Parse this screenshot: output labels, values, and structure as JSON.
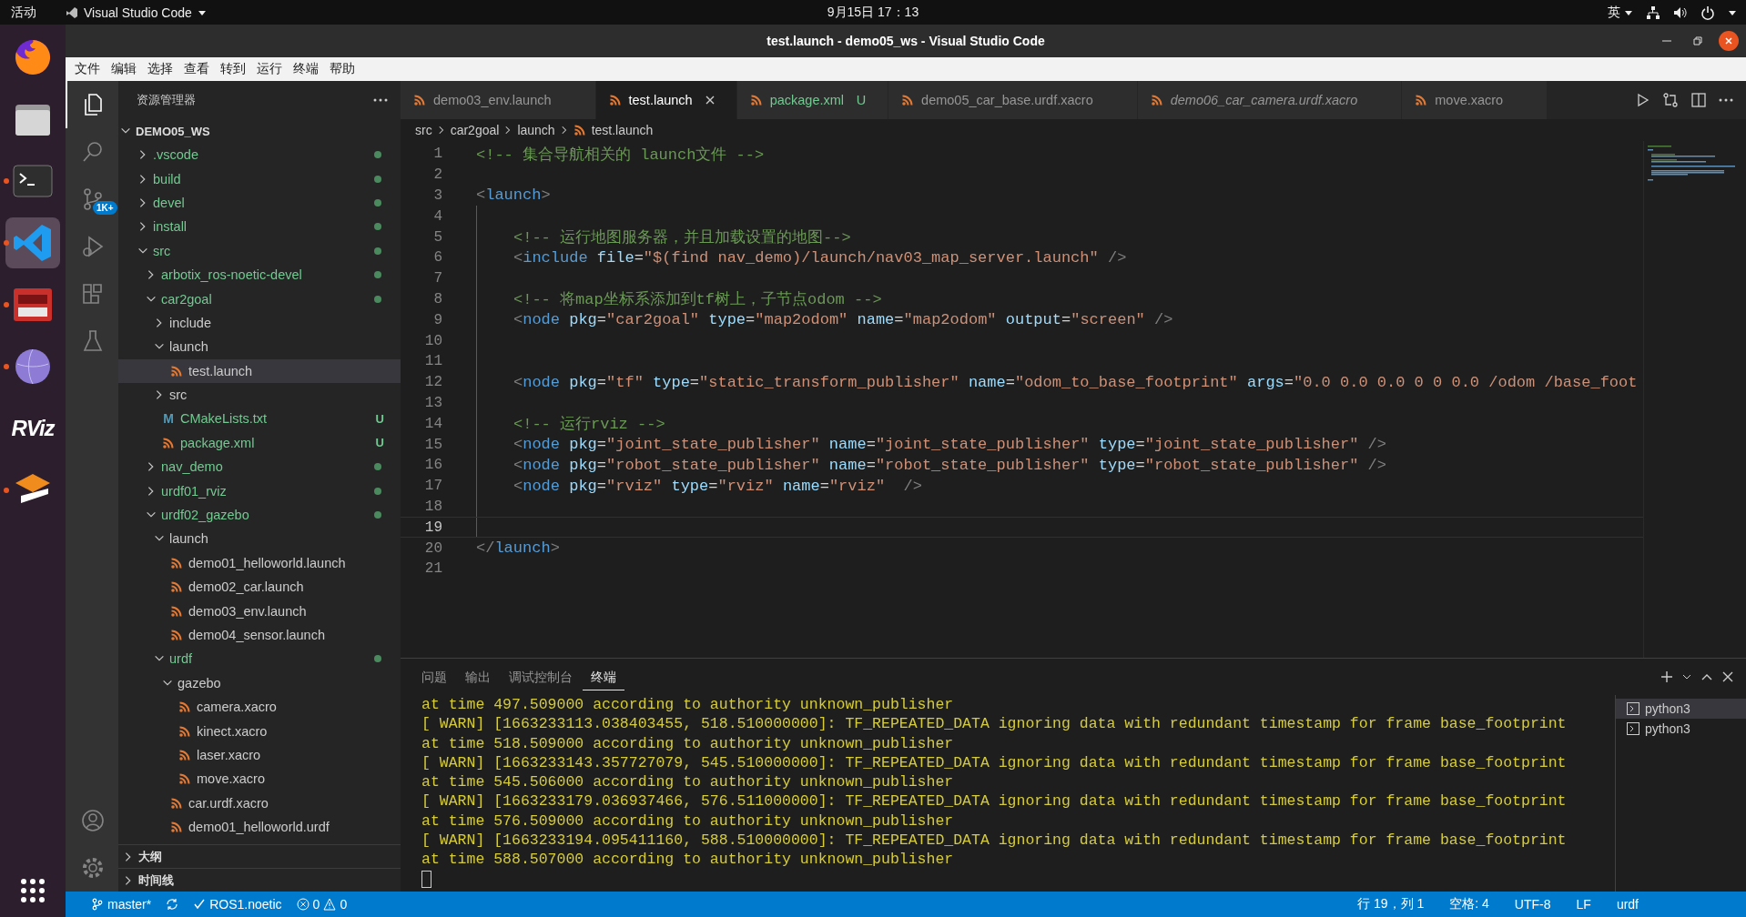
{
  "top_bar": {
    "activities": "活动",
    "app_menu": "Visual Studio Code",
    "clock": "9月15日  17：13",
    "input_method": "英"
  },
  "dock": {
    "items": [
      {
        "kind": "browser",
        "running": false,
        "selected": false
      },
      {
        "kind": "files",
        "running": false,
        "selected": false
      },
      {
        "kind": "terminal",
        "running": true,
        "selected": false
      },
      {
        "kind": "editor",
        "running": true,
        "selected": true
      },
      {
        "kind": "red-app",
        "running": true,
        "selected": false
      },
      {
        "kind": "sphere",
        "running": true,
        "selected": false
      },
      {
        "kind": "text",
        "label": "RViz",
        "running": false,
        "selected": false
      },
      {
        "kind": "layers",
        "running": true,
        "selected": false
      }
    ]
  },
  "window": {
    "title": "test.launch - demo05_ws - Visual Studio Code"
  },
  "menu": [
    "文件",
    "编辑",
    "选择",
    "查看",
    "转到",
    "运行",
    "终端",
    "帮助"
  ],
  "activity_bar": {
    "items": [
      {
        "kind": "explorer",
        "selected": true
      },
      {
        "kind": "search",
        "selected": false
      },
      {
        "kind": "source-control",
        "selected": false,
        "badge": "1K+"
      },
      {
        "kind": "run",
        "selected": false
      },
      {
        "kind": "extensions",
        "selected": false
      },
      {
        "kind": "testing",
        "selected": false
      }
    ]
  },
  "sidebar": {
    "title": "资源管理器",
    "root": {
      "label": "DEMO05_WS",
      "expanded": true
    },
    "tree": [
      {
        "kind": "folder",
        "label": ".vscode",
        "expanded": false,
        "untracked": true,
        "dot": true,
        "selected": false
      },
      {
        "kind": "folder",
        "label": "build",
        "expanded": false,
        "untracked": true,
        "dot": true,
        "selected": false
      },
      {
        "kind": "folder",
        "label": "devel",
        "expanded": false,
        "untracked": true,
        "dot": true,
        "selected": false
      },
      {
        "kind": "folder",
        "label": "install",
        "expanded": false,
        "untracked": true,
        "dot": true,
        "selected": false
      },
      {
        "kind": "folder",
        "label": "src",
        "expanded": true,
        "untracked": true,
        "dot": true,
        "selected": false,
        "children": [
          {
            "kind": "folder",
            "label": "arbotix_ros-noetic-devel",
            "expanded": false,
            "untracked": true,
            "dot": true,
            "selected": false
          },
          {
            "kind": "folder",
            "label": "car2goal",
            "expanded": true,
            "untracked": true,
            "dot": true,
            "selected": false,
            "children": [
              {
                "kind": "folder",
                "label": "include",
                "expanded": false,
                "untracked": false,
                "dot": false,
                "selected": false
              },
              {
                "kind": "folder",
                "label": "launch",
                "expanded": true,
                "untracked": false,
                "dot": false,
                "selected": false,
                "children": [
                  {
                    "kind": "xml",
                    "label": "test.launch",
                    "untracked": false,
                    "selected": true
                  }
                ]
              },
              {
                "kind": "folder",
                "label": "src",
                "expanded": false,
                "untracked": false,
                "dot": false,
                "selected": false
              },
              {
                "kind": "cmake",
                "glyph": "M",
                "label": "CMakeLists.txt",
                "untracked": true,
                "badge": "U",
                "selected": false
              },
              {
                "kind": "xml",
                "label": "package.xml",
                "untracked": true,
                "badge": "U",
                "selected": false
              }
            ]
          },
          {
            "kind": "folder",
            "label": "nav_demo",
            "expanded": false,
            "untracked": true,
            "dot": true,
            "selected": false
          },
          {
            "kind": "folder",
            "label": "urdf01_rviz",
            "expanded": false,
            "untracked": true,
            "dot": true,
            "selected": false
          },
          {
            "kind": "folder",
            "label": "urdf02_gazebo",
            "expanded": true,
            "untracked": true,
            "dot": true,
            "selected": false,
            "children": [
              {
                "kind": "folder",
                "label": "launch",
                "expanded": true,
                "untracked": false,
                "dot": false,
                "selected": false,
                "children": [
                  {
                    "kind": "xml",
                    "label": "demo01_helloworld.launch",
                    "untracked": false,
                    "selected": false
                  },
                  {
                    "kind": "xml",
                    "label": "demo02_car.launch",
                    "untracked": false,
                    "selected": false
                  },
                  {
                    "kind": "xml",
                    "label": "demo03_env.launch",
                    "untracked": false,
                    "selected": false
                  },
                  {
                    "kind": "xml",
                    "label": "demo04_sensor.launch",
                    "untracked": false,
                    "selected": false
                  }
                ]
              },
              {
                "kind": "folder",
                "label": "urdf",
                "expanded": true,
                "untracked": true,
                "dot": true,
                "selected": false,
                "children": [
                  {
                    "kind": "folder",
                    "label": "gazebo",
                    "expanded": true,
                    "untracked": false,
                    "dot": false,
                    "selected": false,
                    "children": [
                      {
                        "kind": "xml",
                        "label": "camera.xacro",
                        "untracked": false,
                        "selected": false
                      },
                      {
                        "kind": "xml",
                        "label": "kinect.xacro",
                        "untracked": false,
                        "selected": false
                      },
                      {
                        "kind": "xml",
                        "label": "laser.xacro",
                        "untracked": false,
                        "selected": false
                      },
                      {
                        "kind": "xml",
                        "label": "move.xacro",
                        "untracked": false,
                        "selected": false
                      }
                    ]
                  },
                  {
                    "kind": "xml",
                    "label": "car.urdf.xacro",
                    "untracked": false,
                    "selected": false
                  },
                  {
                    "kind": "xml",
                    "label": "demo01_helloworld.urdf",
                    "untracked": false,
                    "selected": false
                  }
                ]
              }
            ]
          }
        ]
      }
    ],
    "sections": [
      {
        "label": "大纲",
        "expanded": false
      },
      {
        "label": "时间线",
        "expanded": false
      }
    ]
  },
  "tabs": [
    {
      "label": "demo03_env.launch",
      "selected": false,
      "preview": false,
      "untracked": false
    },
    {
      "label": "test.launch",
      "selected": true,
      "preview": false,
      "untracked": false
    },
    {
      "label": "package.xml",
      "selected": false,
      "preview": false,
      "untracked": true,
      "badge": "U"
    },
    {
      "label": "demo05_car_base.urdf.xacro",
      "selected": false,
      "preview": false,
      "untracked": false
    },
    {
      "label": "demo06_car_camera.urdf.xacro",
      "selected": false,
      "preview": true,
      "untracked": false
    },
    {
      "label": "move.xacro",
      "selected": false,
      "preview": false,
      "untracked": false
    }
  ],
  "breadcrumb": [
    "src",
    "car2goal",
    "launch",
    "test.launch"
  ],
  "editor": {
    "lines": [
      {
        "number": "1",
        "indented": false,
        "current": false,
        "tokens": [
          {
            "kind": "comment",
            "text": "<!-- 集合导航相关的 launch文件 -->"
          }
        ]
      },
      {
        "number": "2",
        "indented": false,
        "current": false
      },
      {
        "number": "3",
        "indented": false,
        "current": false,
        "tokens": [
          {
            "kind": "punct",
            "text": "<"
          },
          {
            "kind": "tag",
            "text": "launch"
          },
          {
            "kind": "punct",
            "text": ">"
          }
        ]
      },
      {
        "number": "4",
        "indented": true,
        "current": false
      },
      {
        "number": "5",
        "indented": true,
        "current": false,
        "tokens": [
          {
            "kind": "comment",
            "text": "<!-- 运行地图服务器，并且加载设置的地图-->"
          }
        ]
      },
      {
        "number": "6",
        "indented": true,
        "current": false,
        "tokens": [
          {
            "kind": "punct",
            "text": "<"
          },
          {
            "kind": "tag",
            "text": "include"
          },
          {
            "kind": "attr",
            "text": " file"
          },
          {
            "kind": "equals",
            "text": "="
          },
          {
            "kind": "string",
            "text": "\"$(find nav_demo)/launch/nav03_map_server.launch\""
          },
          {
            "kind": "punct",
            "text": " />"
          }
        ]
      },
      {
        "number": "7",
        "indented": true,
        "current": false
      },
      {
        "number": "8",
        "indented": true,
        "current": false,
        "tokens": [
          {
            "kind": "comment",
            "text": "<!-- 将map坐标系添加到tf树上，子节点odom -->"
          }
        ]
      },
      {
        "number": "9",
        "indented": true,
        "current": false,
        "tokens": [
          {
            "kind": "punct",
            "text": "<"
          },
          {
            "kind": "tag",
            "text": "node"
          },
          {
            "kind": "attr",
            "text": " pkg"
          },
          {
            "kind": "equals",
            "text": "="
          },
          {
            "kind": "string",
            "text": "\"car2goal\""
          },
          {
            "kind": "attr",
            "text": " type"
          },
          {
            "kind": "equals",
            "text": "="
          },
          {
            "kind": "string",
            "text": "\"map2odom\""
          },
          {
            "kind": "attr",
            "text": " name"
          },
          {
            "kind": "equals",
            "text": "="
          },
          {
            "kind": "string",
            "text": "\"map2odom\""
          },
          {
            "kind": "attr",
            "text": " output"
          },
          {
            "kind": "equals",
            "text": "="
          },
          {
            "kind": "string",
            "text": "\"screen\""
          },
          {
            "kind": "punct",
            "text": " />"
          }
        ]
      },
      {
        "number": "10",
        "indented": true,
        "current": false
      },
      {
        "number": "11",
        "indented": true,
        "current": false
      },
      {
        "number": "12",
        "indented": true,
        "current": false,
        "tokens": [
          {
            "kind": "punct",
            "text": "<"
          },
          {
            "kind": "tag",
            "text": "node"
          },
          {
            "kind": "attr",
            "text": " pkg"
          },
          {
            "kind": "equals",
            "text": "="
          },
          {
            "kind": "string",
            "text": "\"tf\""
          },
          {
            "kind": "attr",
            "text": " type"
          },
          {
            "kind": "equals",
            "text": "="
          },
          {
            "kind": "string",
            "text": "\"static_transform_publisher\""
          },
          {
            "kind": "attr",
            "text": " name"
          },
          {
            "kind": "equals",
            "text": "="
          },
          {
            "kind": "string",
            "text": "\"odom_to_base_footprint\""
          },
          {
            "kind": "attr",
            "text": " args"
          },
          {
            "kind": "equals",
            "text": "="
          },
          {
            "kind": "string",
            "text": "\"0.0 0.0 0.0 0 0 0.0 /odom /base_foot"
          }
        ]
      },
      {
        "number": "13",
        "indented": true,
        "current": false
      },
      {
        "number": "14",
        "indented": true,
        "current": false,
        "tokens": [
          {
            "kind": "comment",
            "text": "<!-- 运行rviz -->"
          }
        ]
      },
      {
        "number": "15",
        "indented": true,
        "current": false,
        "tokens": [
          {
            "kind": "punct",
            "text": "<"
          },
          {
            "kind": "tag",
            "text": "node"
          },
          {
            "kind": "attr",
            "text": " pkg"
          },
          {
            "kind": "equals",
            "text": "="
          },
          {
            "kind": "string",
            "text": "\"joint_state_publisher\""
          },
          {
            "kind": "attr",
            "text": " name"
          },
          {
            "kind": "equals",
            "text": "="
          },
          {
            "kind": "string",
            "text": "\"joint_state_publisher\""
          },
          {
            "kind": "attr",
            "text": " type"
          },
          {
            "kind": "equals",
            "text": "="
          },
          {
            "kind": "string",
            "text": "\"joint_state_publisher\""
          },
          {
            "kind": "punct",
            "text": " />"
          }
        ]
      },
      {
        "number": "16",
        "indented": true,
        "current": false,
        "tokens": [
          {
            "kind": "punct",
            "text": "<"
          },
          {
            "kind": "tag",
            "text": "node"
          },
          {
            "kind": "attr",
            "text": " pkg"
          },
          {
            "kind": "equals",
            "text": "="
          },
          {
            "kind": "string",
            "text": "\"robot_state_publisher\""
          },
          {
            "kind": "attr",
            "text": " name"
          },
          {
            "kind": "equals",
            "text": "="
          },
          {
            "kind": "string",
            "text": "\"robot_state_publisher\""
          },
          {
            "kind": "attr",
            "text": " type"
          },
          {
            "kind": "equals",
            "text": "="
          },
          {
            "kind": "string",
            "text": "\"robot_state_publisher\""
          },
          {
            "kind": "punct",
            "text": " />"
          }
        ]
      },
      {
        "number": "17",
        "indented": true,
        "current": false,
        "tokens": [
          {
            "kind": "punct",
            "text": "<"
          },
          {
            "kind": "tag",
            "text": "node"
          },
          {
            "kind": "attr",
            "text": " pkg"
          },
          {
            "kind": "equals",
            "text": "="
          },
          {
            "kind": "string",
            "text": "\"rviz\""
          },
          {
            "kind": "attr",
            "text": " type"
          },
          {
            "kind": "equals",
            "text": "="
          },
          {
            "kind": "string",
            "text": "\"rviz\""
          },
          {
            "kind": "attr",
            "text": " name"
          },
          {
            "kind": "equals",
            "text": "="
          },
          {
            "kind": "string",
            "text": "\"rviz\""
          },
          {
            "kind": "punct",
            "text": "  />"
          }
        ]
      },
      {
        "number": "18",
        "indented": true,
        "current": false
      },
      {
        "number": "19",
        "indented": true,
        "current": true
      },
      {
        "number": "20",
        "indented": false,
        "current": false,
        "tokens": [
          {
            "kind": "punct",
            "text": "</"
          },
          {
            "kind": "tag",
            "text": "launch"
          },
          {
            "kind": "punct",
            "text": ">"
          }
        ]
      },
      {
        "number": "21",
        "indented": false,
        "current": false
      }
    ]
  },
  "panel": {
    "tabs": [
      {
        "label": "问题",
        "selected": false
      },
      {
        "label": "输出",
        "selected": false
      },
      {
        "label": "调试控制台",
        "selected": false
      },
      {
        "label": "终端",
        "selected": true
      }
    ],
    "terminal_lines": [
      "at time 497.509000 according to authority unknown_publisher",
      "[ WARN] [1663233113.038403455, 518.510000000]: TF_REPEATED_DATA ignoring data with redundant timestamp for frame base_footprint",
      "at time 518.509000 according to authority unknown_publisher",
      "[ WARN] [1663233143.357727079, 545.510000000]: TF_REPEATED_DATA ignoring data with redundant timestamp for frame base_footprint",
      "at time 545.506000 according to authority unknown_publisher",
      "[ WARN] [1663233179.036937466, 576.511000000]: TF_REPEATED_DATA ignoring data with redundant timestamp for frame base_footprint",
      "at time 576.509000 according to authority unknown_publisher",
      "[ WARN] [1663233194.095411160, 588.510000000]: TF_REPEATED_DATA ignoring data with redundant timestamp for frame base_footprint",
      "at time 588.507000 according to authority unknown_publisher"
    ],
    "terminals": [
      {
        "label": "python3",
        "selected": true
      },
      {
        "label": "python3",
        "selected": false
      }
    ]
  },
  "status_bar": {
    "branch": "master*",
    "ros": "ROS1.noetic",
    "errors": "0",
    "warnings": "0",
    "right": [
      "行 19，列 1",
      "空格: 4",
      "UTF-8",
      "LF",
      "urdf"
    ]
  }
}
